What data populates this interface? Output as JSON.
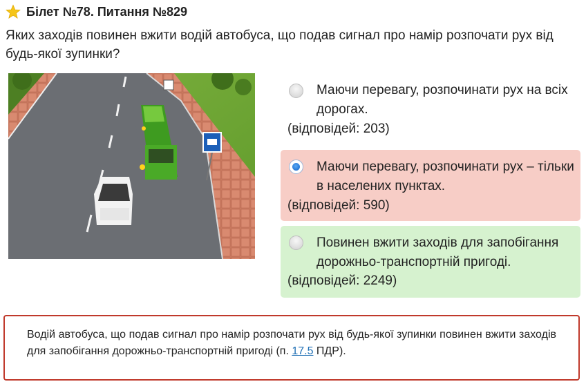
{
  "header": {
    "title": "Білет №78. Питання №829",
    "star_color": "#f5c518"
  },
  "question": {
    "text": "Яких заходів повинен вжити водій автобуса, що подав сигнал про намір розпочати рух від будь-якої зупинки?"
  },
  "answers": [
    {
      "text": "Маючи перевагу, розпочинати рух на всіх дорогах.",
      "count": "(відповідей: 203)",
      "state": "neutral",
      "selected": false
    },
    {
      "text": "Маючи перевагу, розпочинати рух – тільки в населених пунктах.",
      "count": "(відповідей: 590)",
      "state": "wrong",
      "selected": true
    },
    {
      "text": "Повинен вжити заходів для запобігання дорожньо-транспортній пригоді.",
      "count": "(відповідей: 2249)",
      "state": "correct",
      "selected": false
    }
  ],
  "explanation": {
    "text_before": "Водій автобуса, що подав сигнал про намір розпочати рух від будь-якої зупинки повинен вжити заходів для запобігання дорожньо-транспортній пригоді (п. ",
    "link": "17.5",
    "text_after": " ПДР)."
  },
  "colors": {
    "wrong_bg": "#f7cdc6",
    "correct_bg": "#d6f2cf",
    "explain_border": "#c0392b",
    "link": "#1f6fb5"
  }
}
